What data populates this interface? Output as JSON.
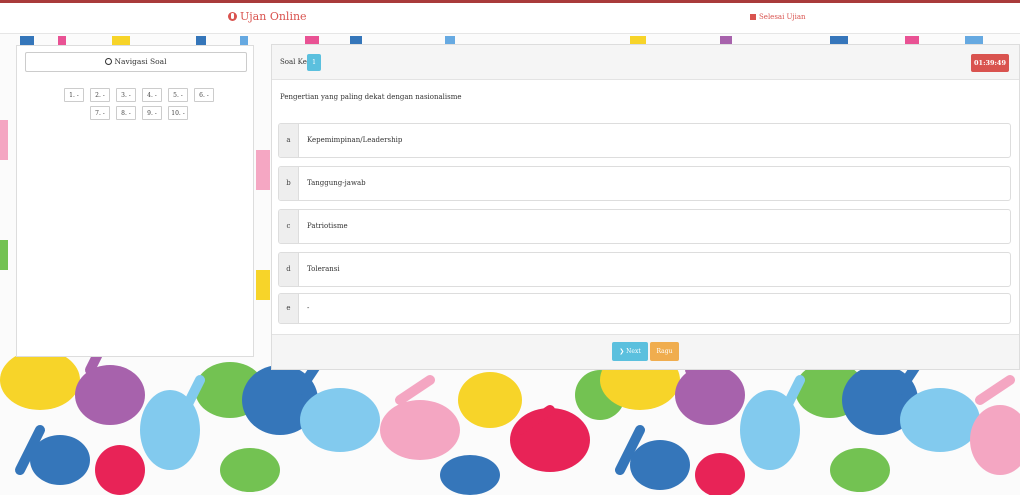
{
  "header": {
    "brand": "Ujan Online",
    "finish_label": "Selesai Ujian"
  },
  "navigation": {
    "button_label": "Navigasi Soal",
    "rows": [
      [
        "1. -",
        "2. -",
        "3. -",
        "4. -",
        "5. -",
        "6. -"
      ],
      [
        "7. -",
        "8. -",
        "9. -",
        "10. -"
      ]
    ]
  },
  "question": {
    "label": "Soal Ke",
    "number": "1",
    "timer": "01:39:49",
    "text": "Pengertian yang paling dekat dengan nasionalisme",
    "options": [
      {
        "letter": "a",
        "text": "Kepemimpinan/Leadership"
      },
      {
        "letter": "b",
        "text": "Tanggung-jawab"
      },
      {
        "letter": "c",
        "text": "Patriotisme"
      },
      {
        "letter": "d",
        "text": "Toleransi"
      },
      {
        "letter": "e",
        "text": "-"
      }
    ],
    "next_label": "Next",
    "doubt_label": "Ragu"
  },
  "colors": {
    "accent_red": "#d9534f",
    "info_blue": "#5bc0de",
    "warning_orange": "#f0ad4e"
  }
}
